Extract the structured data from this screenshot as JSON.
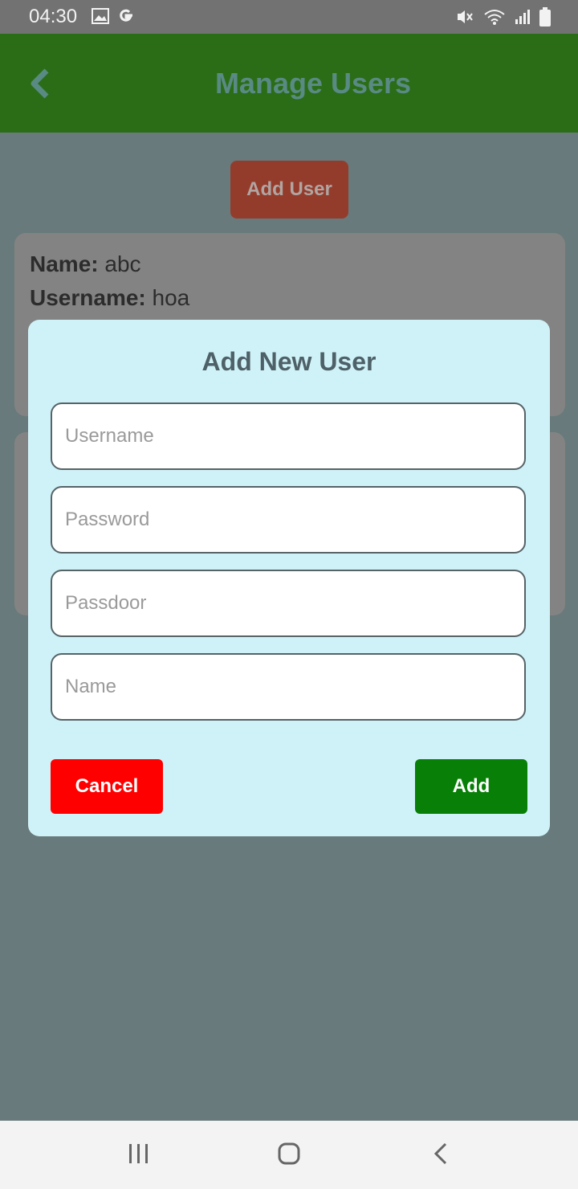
{
  "status_bar": {
    "time": "04:30",
    "left_icons": [
      "image-icon",
      "google-icon"
    ],
    "right_icons": [
      "mute-icon",
      "wifi-icon",
      "signal-icon",
      "battery-icon"
    ]
  },
  "header": {
    "title": "Manage Users",
    "back_icon": "chevron-left-icon",
    "color": "#2a6d16"
  },
  "main": {
    "add_user_label": "Add User",
    "users": [
      {
        "name_label": "Name:",
        "name": "abc",
        "username_label": "Username:",
        "username": "hoa"
      }
    ]
  },
  "modal": {
    "title": "Add New User",
    "fields": [
      {
        "placeholder": "Username",
        "value": ""
      },
      {
        "placeholder": "Password",
        "value": ""
      },
      {
        "placeholder": "Passdoor",
        "value": ""
      },
      {
        "placeholder": "Name",
        "value": ""
      }
    ],
    "cancel_label": "Cancel",
    "add_label": "Add",
    "colors": {
      "cancel": "#ff0000",
      "add": "#087f07",
      "background": "#cff2f8"
    }
  },
  "nav_bar": {
    "items": [
      "recent-apps-icon",
      "home-icon",
      "back-icon"
    ]
  }
}
